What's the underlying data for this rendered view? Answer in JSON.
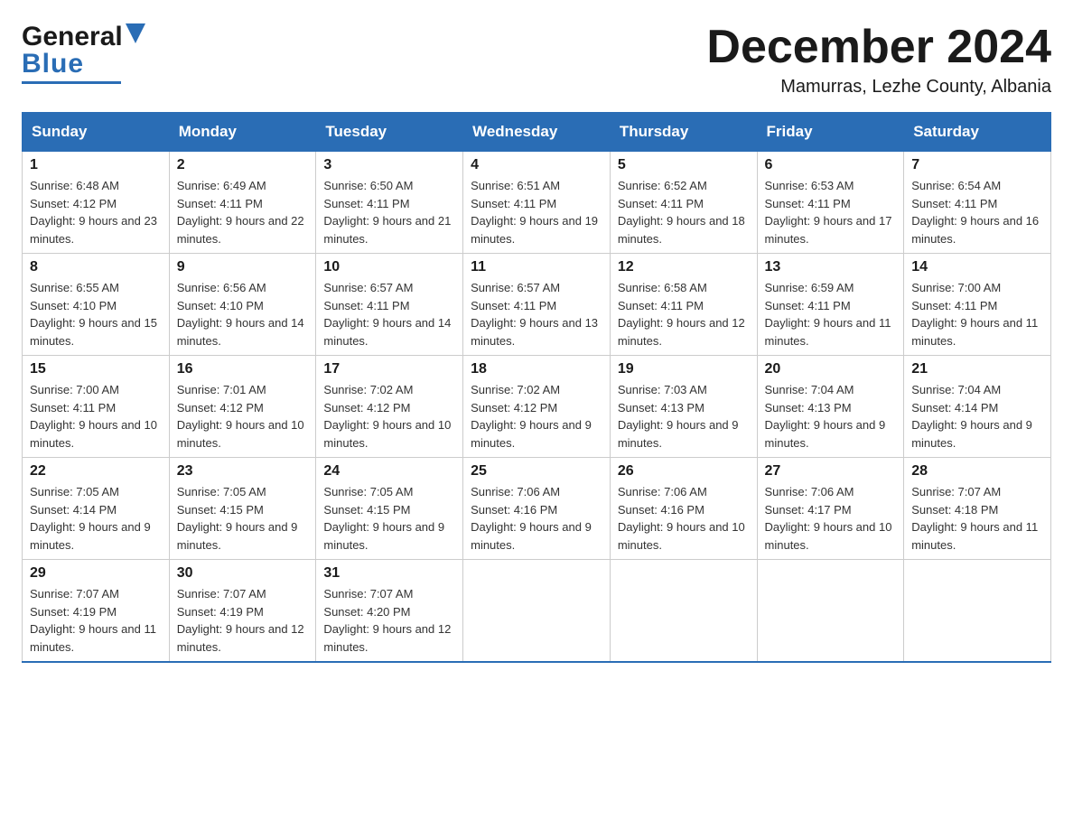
{
  "header": {
    "logo_general": "General",
    "logo_blue": "Blue",
    "month_title": "December 2024",
    "location": "Mamurras, Lezhe County, Albania"
  },
  "days_of_week": [
    "Sunday",
    "Monday",
    "Tuesday",
    "Wednesday",
    "Thursday",
    "Friday",
    "Saturday"
  ],
  "weeks": [
    [
      {
        "day": "1",
        "sunrise": "6:48 AM",
        "sunset": "4:12 PM",
        "daylight": "9 hours and 23 minutes."
      },
      {
        "day": "2",
        "sunrise": "6:49 AM",
        "sunset": "4:11 PM",
        "daylight": "9 hours and 22 minutes."
      },
      {
        "day": "3",
        "sunrise": "6:50 AM",
        "sunset": "4:11 PM",
        "daylight": "9 hours and 21 minutes."
      },
      {
        "day": "4",
        "sunrise": "6:51 AM",
        "sunset": "4:11 PM",
        "daylight": "9 hours and 19 minutes."
      },
      {
        "day": "5",
        "sunrise": "6:52 AM",
        "sunset": "4:11 PM",
        "daylight": "9 hours and 18 minutes."
      },
      {
        "day": "6",
        "sunrise": "6:53 AM",
        "sunset": "4:11 PM",
        "daylight": "9 hours and 17 minutes."
      },
      {
        "day": "7",
        "sunrise": "6:54 AM",
        "sunset": "4:11 PM",
        "daylight": "9 hours and 16 minutes."
      }
    ],
    [
      {
        "day": "8",
        "sunrise": "6:55 AM",
        "sunset": "4:10 PM",
        "daylight": "9 hours and 15 minutes."
      },
      {
        "day": "9",
        "sunrise": "6:56 AM",
        "sunset": "4:10 PM",
        "daylight": "9 hours and 14 minutes."
      },
      {
        "day": "10",
        "sunrise": "6:57 AM",
        "sunset": "4:11 PM",
        "daylight": "9 hours and 14 minutes."
      },
      {
        "day": "11",
        "sunrise": "6:57 AM",
        "sunset": "4:11 PM",
        "daylight": "9 hours and 13 minutes."
      },
      {
        "day": "12",
        "sunrise": "6:58 AM",
        "sunset": "4:11 PM",
        "daylight": "9 hours and 12 minutes."
      },
      {
        "day": "13",
        "sunrise": "6:59 AM",
        "sunset": "4:11 PM",
        "daylight": "9 hours and 11 minutes."
      },
      {
        "day": "14",
        "sunrise": "7:00 AM",
        "sunset": "4:11 PM",
        "daylight": "9 hours and 11 minutes."
      }
    ],
    [
      {
        "day": "15",
        "sunrise": "7:00 AM",
        "sunset": "4:11 PM",
        "daylight": "9 hours and 10 minutes."
      },
      {
        "day": "16",
        "sunrise": "7:01 AM",
        "sunset": "4:12 PM",
        "daylight": "9 hours and 10 minutes."
      },
      {
        "day": "17",
        "sunrise": "7:02 AM",
        "sunset": "4:12 PM",
        "daylight": "9 hours and 10 minutes."
      },
      {
        "day": "18",
        "sunrise": "7:02 AM",
        "sunset": "4:12 PM",
        "daylight": "9 hours and 9 minutes."
      },
      {
        "day": "19",
        "sunrise": "7:03 AM",
        "sunset": "4:13 PM",
        "daylight": "9 hours and 9 minutes."
      },
      {
        "day": "20",
        "sunrise": "7:04 AM",
        "sunset": "4:13 PM",
        "daylight": "9 hours and 9 minutes."
      },
      {
        "day": "21",
        "sunrise": "7:04 AM",
        "sunset": "4:14 PM",
        "daylight": "9 hours and 9 minutes."
      }
    ],
    [
      {
        "day": "22",
        "sunrise": "7:05 AM",
        "sunset": "4:14 PM",
        "daylight": "9 hours and 9 minutes."
      },
      {
        "day": "23",
        "sunrise": "7:05 AM",
        "sunset": "4:15 PM",
        "daylight": "9 hours and 9 minutes."
      },
      {
        "day": "24",
        "sunrise": "7:05 AM",
        "sunset": "4:15 PM",
        "daylight": "9 hours and 9 minutes."
      },
      {
        "day": "25",
        "sunrise": "7:06 AM",
        "sunset": "4:16 PM",
        "daylight": "9 hours and 9 minutes."
      },
      {
        "day": "26",
        "sunrise": "7:06 AM",
        "sunset": "4:16 PM",
        "daylight": "9 hours and 10 minutes."
      },
      {
        "day": "27",
        "sunrise": "7:06 AM",
        "sunset": "4:17 PM",
        "daylight": "9 hours and 10 minutes."
      },
      {
        "day": "28",
        "sunrise": "7:07 AM",
        "sunset": "4:18 PM",
        "daylight": "9 hours and 11 minutes."
      }
    ],
    [
      {
        "day": "29",
        "sunrise": "7:07 AM",
        "sunset": "4:19 PM",
        "daylight": "9 hours and 11 minutes."
      },
      {
        "day": "30",
        "sunrise": "7:07 AM",
        "sunset": "4:19 PM",
        "daylight": "9 hours and 12 minutes."
      },
      {
        "day": "31",
        "sunrise": "7:07 AM",
        "sunset": "4:20 PM",
        "daylight": "9 hours and 12 minutes."
      },
      null,
      null,
      null,
      null
    ]
  ]
}
